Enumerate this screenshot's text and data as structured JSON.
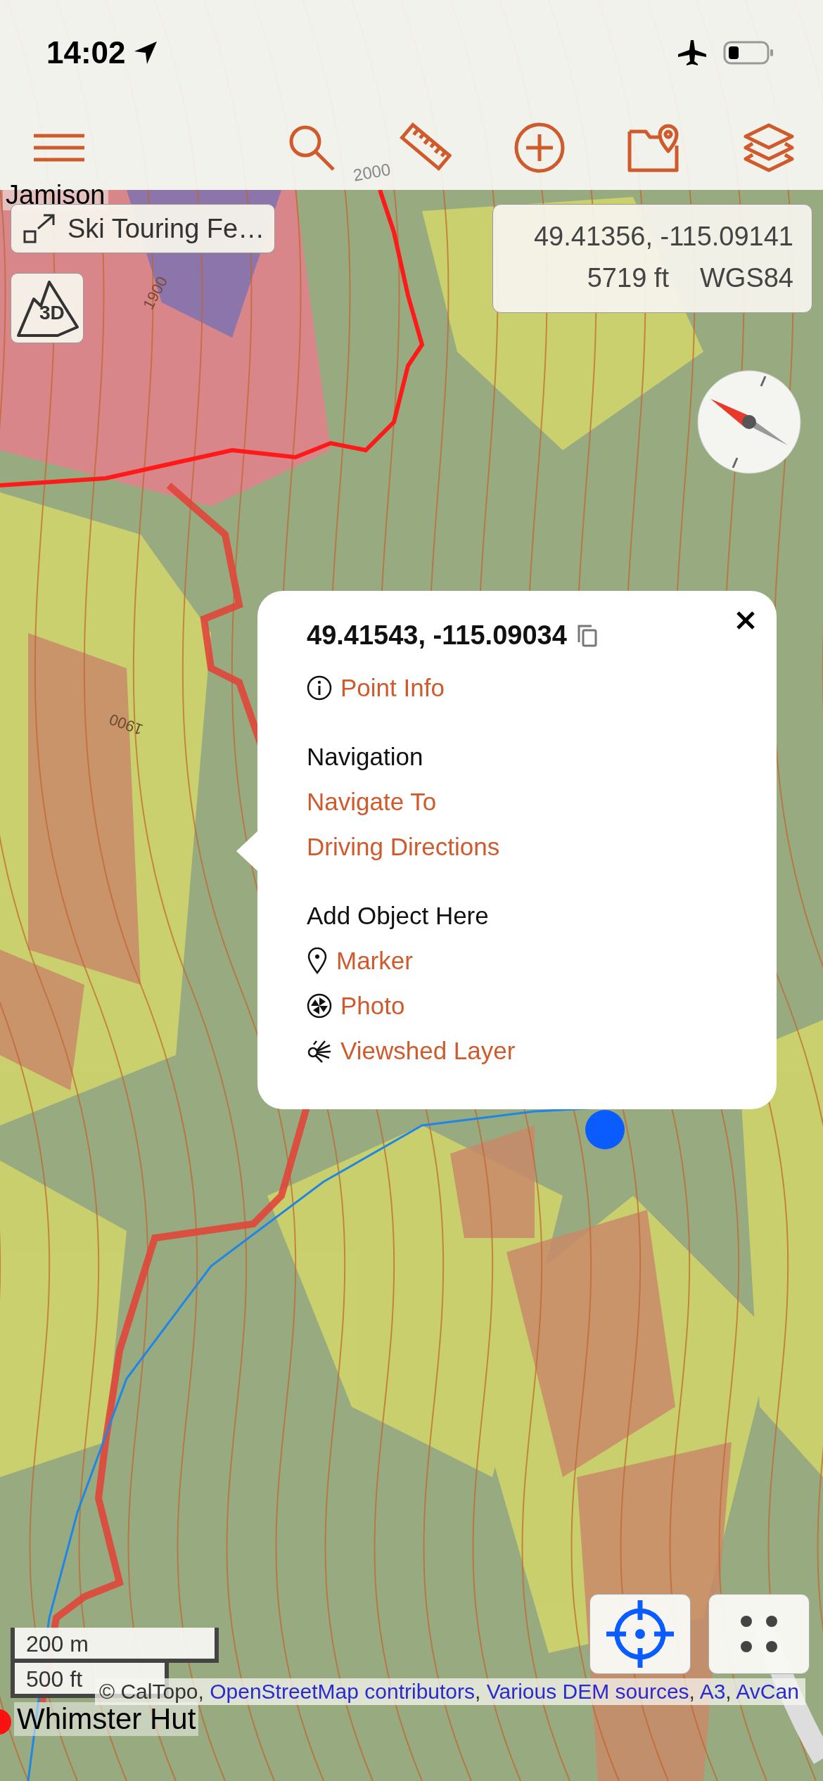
{
  "status_bar": {
    "time": "14:02"
  },
  "map": {
    "labels": [
      {
        "kind": "place",
        "text": "Jamison"
      },
      {
        "kind": "contour",
        "text": "2000"
      },
      {
        "kind": "contour",
        "text": "1900"
      },
      {
        "kind": "contour",
        "text": "1900"
      },
      {
        "kind": "place",
        "text": "Whimster Hut"
      }
    ]
  },
  "layer_button": {
    "label": "Ski Touring Fe…"
  },
  "view_3d_button": {
    "label": "3D"
  },
  "cursor_info": {
    "coordinates": "49.41356, -115.09141",
    "elevation": "5719 ft",
    "datum": "WGS84"
  },
  "popup": {
    "coordinates": "49.41543, -115.09034",
    "items": [
      {
        "kind": "icon-link",
        "label": "Point Info"
      },
      {
        "kind": "heading",
        "label": "Navigation"
      },
      {
        "kind": "link",
        "label": "Navigate To"
      },
      {
        "kind": "link",
        "label": "Driving Directions"
      },
      {
        "kind": "heading",
        "label": "Add Object Here"
      },
      {
        "kind": "icon-link",
        "label": "Marker"
      },
      {
        "kind": "icon-link",
        "label": "Photo"
      },
      {
        "kind": "icon-link",
        "label": "Viewshed Layer"
      }
    ]
  },
  "scale": [
    "200 m",
    "500 ft"
  ],
  "attribution": [
    {
      "kind": "text",
      "text": "© CalTopo, "
    },
    {
      "kind": "link",
      "text": "OpenStreetMap contributors"
    },
    {
      "kind": "text",
      "text": ", "
    },
    {
      "kind": "link",
      "text": "Various DEM sources"
    },
    {
      "kind": "text",
      "text": ", "
    },
    {
      "kind": "link",
      "text": "A3"
    },
    {
      "kind": "text",
      "text": ", "
    },
    {
      "kind": "link",
      "text": "AvCan"
    }
  ]
}
